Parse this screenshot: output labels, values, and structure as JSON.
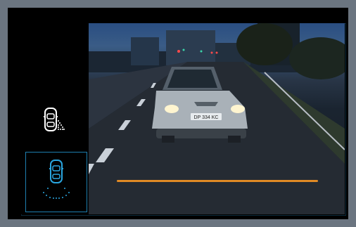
{
  "sidebar": {
    "buttons": [
      {
        "name": "side-camera",
        "icon": "car-side-sensor-icon",
        "active": false
      },
      {
        "name": "rear-camera",
        "icon": "car-rear-sensor-icon",
        "active": true
      }
    ]
  },
  "camera_view": {
    "scene": "rear-camera-feed",
    "license_plate": "DP 334 KC",
    "guide_color": "#e08a25"
  },
  "colors": {
    "active_border": "#1e7fb0",
    "background": "#6b7580",
    "icon": "#ffffff",
    "active_icon": "#2aa6e0"
  }
}
